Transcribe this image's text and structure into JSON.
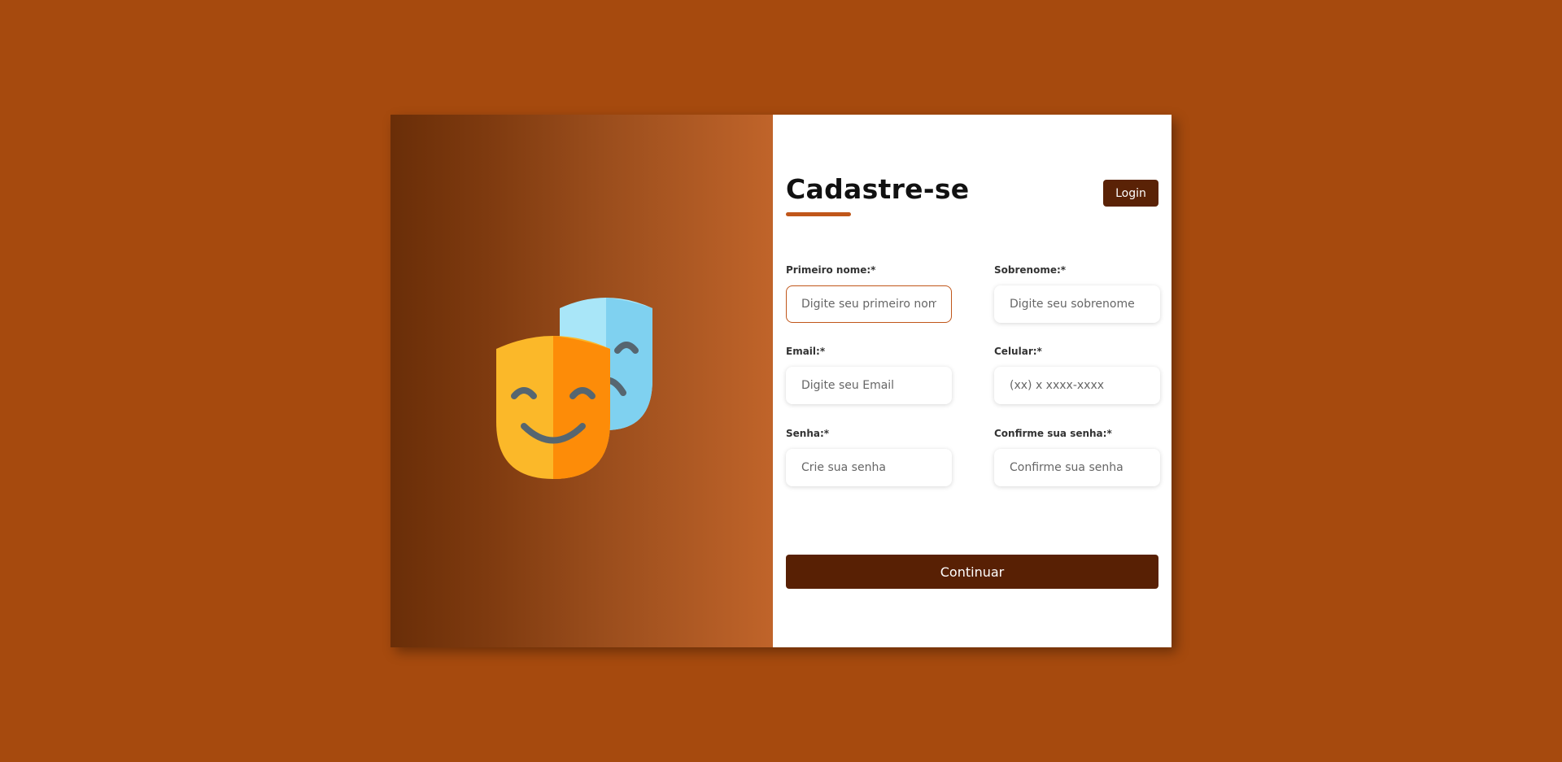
{
  "colors": {
    "background": "#a64a0e",
    "accent": "#c0561a",
    "button": "#5a2206"
  },
  "illustration": {
    "icon": "theater-masks-icon"
  },
  "header": {
    "title": "Cadastre-se",
    "login_label": "Login"
  },
  "form": {
    "first_name": {
      "label": "Primeiro nome:*",
      "placeholder": "Digite seu primeiro nome"
    },
    "last_name": {
      "label": "Sobrenome:*",
      "placeholder": "Digite seu sobrenome"
    },
    "email": {
      "label": "Email:*",
      "placeholder": "Digite seu Email"
    },
    "phone": {
      "label": "Celular:*",
      "placeholder": "(xx) x xxxx-xxxx"
    },
    "password": {
      "label": "Senha:*",
      "placeholder": "Crie sua senha"
    },
    "confirm_password": {
      "label": "Confirme sua senha:*",
      "placeholder": "Confirme sua senha"
    },
    "submit_label": "Continuar"
  }
}
